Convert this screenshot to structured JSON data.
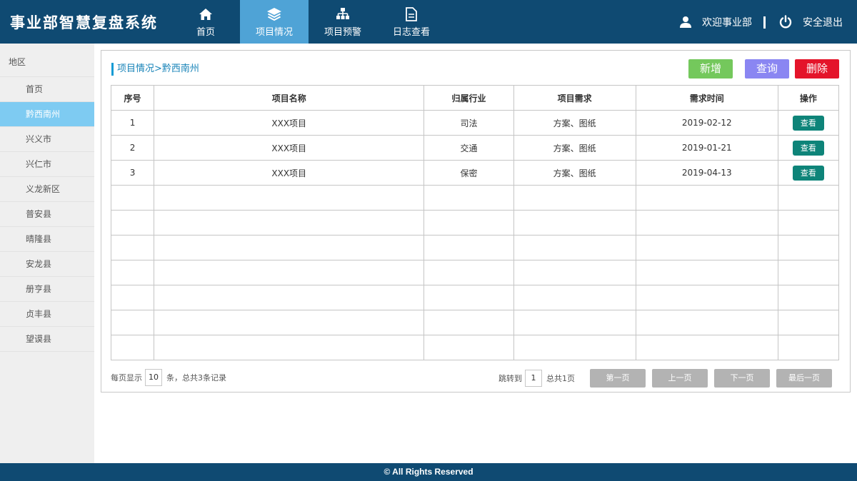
{
  "header": {
    "title": "事业部智慧复盘系统",
    "nav": [
      {
        "label": "首页",
        "icon": "home-icon"
      },
      {
        "label": "项目情况",
        "icon": "layers-icon"
      },
      {
        "label": "项目预警",
        "icon": "sitemap-icon"
      },
      {
        "label": "日志查看",
        "icon": "document-icon"
      }
    ],
    "active_nav": 1,
    "welcome": "欢迎事业部",
    "logout": "安全退出"
  },
  "sidebar": {
    "heading": "地区",
    "items": [
      "首页",
      "黔西南州",
      "兴义市",
      "兴仁市",
      "义龙新区",
      "普安县",
      "晴隆县",
      "安龙县",
      "册亨县",
      "贞丰县",
      "望谟县"
    ],
    "active_index": 1
  },
  "panel": {
    "breadcrumb": "项目情况>黔西南州",
    "buttons": {
      "add": "新增",
      "query": "查询",
      "delete": "删除"
    }
  },
  "table": {
    "headers": [
      "序号",
      "项目名称",
      "归属行业",
      "项目需求",
      "需求时间",
      "操作"
    ],
    "rows": [
      {
        "no": "1",
        "name": "XXX项目",
        "industry": "司法",
        "demand": "方案、图纸",
        "date": "2019-02-12",
        "action": "查看"
      },
      {
        "no": "2",
        "name": "XXX项目",
        "industry": "交通",
        "demand": "方案、图纸",
        "date": "2019-01-21",
        "action": "查看"
      },
      {
        "no": "3",
        "name": "XXX项目",
        "industry": "保密",
        "demand": "方案、图纸",
        "date": "2019-04-13",
        "action": "查看"
      }
    ]
  },
  "pager": {
    "per_page_label": "每页显示",
    "per_page": "10",
    "summary": "条，总共3条记录",
    "jump_label": "跳转到",
    "jump_page": "1",
    "total_pages": "总共1页",
    "first": "第一页",
    "prev": "上一页",
    "next": "下一页",
    "last": "最后一页"
  },
  "footer": {
    "text": "© All Rights Reserved"
  },
  "colors": {
    "header_bg": "#0f4a72",
    "nav_active": "#4fa3d6",
    "side_active": "#7ecbf2",
    "add": "#74c85c",
    "query": "#8a86f2",
    "delete": "#e4142a",
    "view": "#0e8479",
    "pager_btn": "#b3b3b3"
  }
}
